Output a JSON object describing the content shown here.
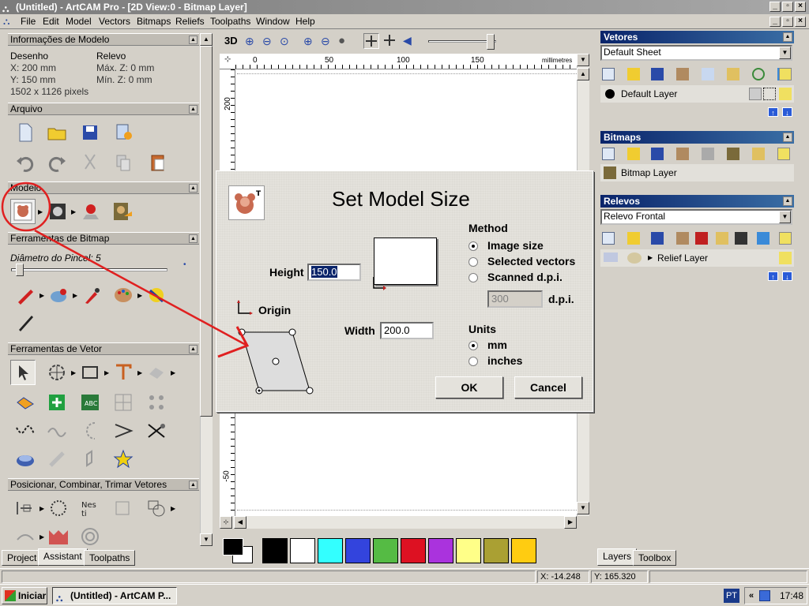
{
  "window": {
    "title": "(Untitled) - ArtCAM Pro - [2D View:0 - Bitmap Layer]"
  },
  "menu": {
    "items": [
      "File",
      "Edit",
      "Model",
      "Vectors",
      "Bitmaps",
      "Reliefs",
      "Toolpaths",
      "Window",
      "Help"
    ]
  },
  "left_panel": {
    "model_info": {
      "header": "Informações de Modelo",
      "col1_title": "Desenho",
      "col1_line1": "X: 200 mm",
      "col1_line2": "Y: 150 mm",
      "col1_line3": "1502 x 1126 pixels",
      "col2_title": "Relevo",
      "col2_line1": "Máx. Z: 0 mm",
      "col2_line2": "Mín. Z: 0 mm"
    },
    "sections": {
      "arquivo": "Arquivo",
      "modelo": "Modelo",
      "bitmap_tools": "Ferramentas de Bitmap",
      "vector_tools": "Ferramentas de Vetor",
      "position_tools": "Posicionar, Combinar, Trimar Vetores"
    },
    "brush_label": "Diâmetro do Pincel: 5",
    "tabs": [
      "Project",
      "Assistant",
      "Toolpaths"
    ]
  },
  "view": {
    "toolbar_3d": "3D",
    "ruler_units": "millimetres",
    "ruler_top_ticks": [
      "0",
      "50",
      "100",
      "150"
    ],
    "ruler_left_ticks": [
      "200",
      "-50"
    ],
    "slider_value": 0.92
  },
  "palette": {
    "colors": [
      "#000000",
      "#ffffff",
      "#33ffff",
      "#3344dd",
      "#55bb44",
      "#dd1122",
      "#aa33dd",
      "#ffff88",
      "#aaa033",
      "#ffcc11"
    ]
  },
  "right_panel": {
    "vetores": {
      "header": "Vetores",
      "dropdown": "Default Sheet",
      "layer": "Default Layer"
    },
    "bitmaps": {
      "header": "Bitmaps",
      "layer": "Bitmap Layer"
    },
    "relevos": {
      "header": "Relevos",
      "dropdown": "Relevo Frontal",
      "layer": "Relief Layer"
    },
    "tabs": [
      "Layers",
      "Toolbox"
    ]
  },
  "status": {
    "x": "X: -14.248",
    "y": "Y: 165.320"
  },
  "taskbar": {
    "start": "Iniciar",
    "task": "(Untitled) - ArtCAM P...",
    "lang": "PT",
    "time": "17:48"
  },
  "dialog": {
    "title": "Set Model Size",
    "height_label": "Height",
    "height_value": "150.0",
    "width_label": "Width",
    "width_value": "200.0",
    "origin_label": "Origin",
    "method_label": "Method",
    "method_options": [
      "Image size",
      "Selected vectors",
      "Scanned d.p.i."
    ],
    "dpi_value": "300",
    "dpi_label": "d.p.i.",
    "units_label": "Units",
    "units_options": [
      "mm",
      "inches"
    ],
    "ok": "OK",
    "cancel": "Cancel"
  },
  "annotation_color": "#e02020"
}
